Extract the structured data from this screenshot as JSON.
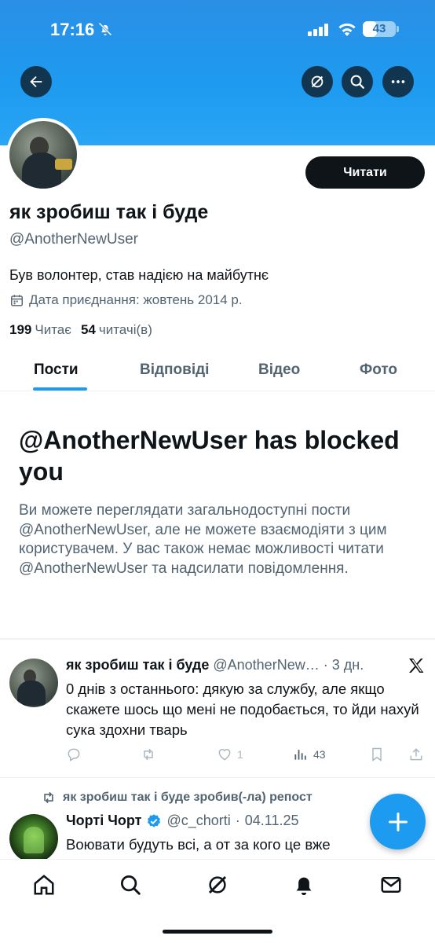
{
  "status_bar": {
    "time": "17:16",
    "battery": "43",
    "battery_level": 0.43,
    "icons": [
      "bell-off-icon",
      "signal-icon",
      "wifi-icon",
      "battery-icon"
    ]
  },
  "header": {
    "buttons": [
      "back-arrow-icon",
      "grok-icon",
      "search-icon",
      "more-icon"
    ]
  },
  "profile": {
    "display_name": "як зробиш так і буде",
    "handle": "@AnotherNewUser",
    "bio": "Був волонтер, став надією на майбутнє",
    "joined": "Дата приєднання: жовтень 2014 р.",
    "following_count": "199",
    "following_label": "Читає",
    "followers_count": "54",
    "followers_label": "читачі(в)",
    "follow_button": "Читати"
  },
  "tabs": [
    {
      "label": "Пости",
      "active": true
    },
    {
      "label": "Відповіді",
      "active": false
    },
    {
      "label": "Відео",
      "active": false
    },
    {
      "label": "Фото",
      "active": false
    }
  ],
  "blocked": {
    "title": "@AnotherNewUser has blocked you",
    "text": "Ви можете переглядати загальнодоступні пости @AnotherNewUser, але не можете взаємодіяти з цим користувачем. У вас також немає можливості читати @AnotherNewUser та надсилати повідомлення."
  },
  "posts": [
    {
      "name": "як зробиш так і буде",
      "handle": "@AnotherNew…",
      "time": "3 дн.",
      "text": "0 днів з останнього: дякую за службу, але якщо скажете шось що мені не подобається, то йди нахуй сука здохни тварь",
      "replies": "",
      "reposts": "",
      "likes": "1",
      "views": "43"
    },
    {
      "repost_label": "як зробиш так і буде зробив(-ла) репост",
      "name": "Чорті Чорт",
      "handle": "@c_chorti",
      "time": "04.11.25",
      "verified": true,
      "text": "Воювати будуть всі, а от за кого це вже"
    }
  ],
  "colors": {
    "accent": "#1d9bf0",
    "text_primary": "#0f1419",
    "text_secondary": "#536471"
  },
  "bottom_nav": [
    "home-icon",
    "search-icon",
    "grok-icon",
    "notifications-icon",
    "messages-icon"
  ]
}
